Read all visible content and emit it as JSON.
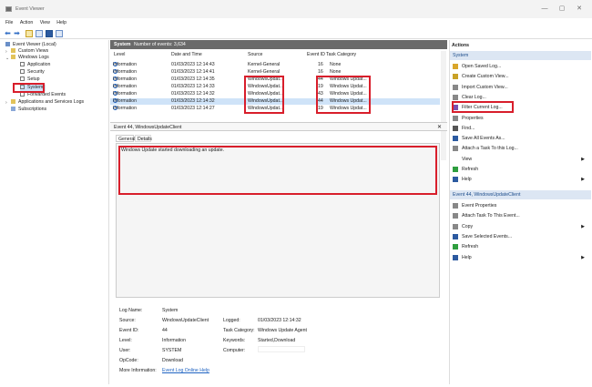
{
  "window": {
    "title": "Event Viewer",
    "minimize": "—",
    "maximize": "▢",
    "close": "✕"
  },
  "menu": [
    "File",
    "Action",
    "View",
    "Help"
  ],
  "tree": {
    "root": "Event Viewer (Local)",
    "custom_views": "Custom Views",
    "windows_logs": "Windows Logs",
    "logs": [
      "Application",
      "Security",
      "Setup",
      "System",
      "Forwarded Events"
    ],
    "app_services": "Applications and Services Logs",
    "subscriptions": "Subscriptions"
  },
  "log_header": {
    "name": "System",
    "count": "Number of events: 3,634"
  },
  "columns": {
    "level": "Level",
    "date": "Date and Time",
    "source": "Source",
    "event_id": "Event ID",
    "task": "Task Category"
  },
  "events": [
    {
      "level": "Information",
      "date": "01/03/2023 12:14:43",
      "source": "Kernel-General",
      "event_id": "16",
      "task": "None"
    },
    {
      "level": "Information",
      "date": "01/03/2023 12:14:41",
      "source": "Kernel-General",
      "event_id": "16",
      "task": "None"
    },
    {
      "level": "Information",
      "date": "01/03/2023 12:14:35",
      "source": "WindowsUpdat...",
      "event_id": "44",
      "task": "Windows Updat..."
    },
    {
      "level": "Information",
      "date": "01/03/2023 12:14:33",
      "source": "WindowsUpdat...",
      "event_id": "19",
      "task": "Windows Updat..."
    },
    {
      "level": "Information",
      "date": "01/03/2023 12:14:32",
      "source": "WindowsUpdat...",
      "event_id": "43",
      "task": "Windows Updat..."
    },
    {
      "level": "Information",
      "date": "01/03/2023 12:14:32",
      "source": "WindowsUpdat...",
      "event_id": "44",
      "task": "Windows Updat..."
    },
    {
      "level": "Information",
      "date": "01/03/2023 12:14:27",
      "source": "WindowsUpdat...",
      "event_id": "19",
      "task": "Windows Updat..."
    }
  ],
  "detail": {
    "title": "Event 44, WindowsUpdateClient",
    "close": "✕",
    "tabs": [
      "General",
      "Details"
    ],
    "message": "Windows Update started downloading an update.",
    "labels": {
      "log_name": "Log Name:",
      "source": "Source:",
      "event_id": "Event ID:",
      "level": "Level:",
      "user": "User:",
      "opcode": "OpCode:",
      "more_info": "More Information:",
      "logged": "Logged:",
      "task_category": "Task Category:",
      "keywords": "Keywords:",
      "computer": "Computer:"
    },
    "values": {
      "log_name": "System",
      "source": "WindowsUpdateClient",
      "event_id": "44",
      "level": "Information",
      "user": "SYSTEM",
      "opcode": "Download",
      "more_info": "Event Log Online Help",
      "logged": "01/03/2023 12:14:32",
      "task_category": "Windows Update Agent",
      "keywords": "Started,Download",
      "computer": ""
    }
  },
  "actions": {
    "header": "Actions",
    "section1": "System",
    "items1": [
      {
        "label": "Open Saved Log...",
        "icon": "folder-icon",
        "color": "#d9a62b"
      },
      {
        "label": "Create Custom View...",
        "icon": "filter-star-icon",
        "color": "#c9a227"
      },
      {
        "label": "Import Custom View...",
        "icon": "import-icon",
        "color": "#888888"
      },
      {
        "label": "Clear Log...",
        "icon": "clear-icon",
        "color": "#888888"
      },
      {
        "label": "Filter Current Log...",
        "icon": "filter-icon",
        "color": "#7a4fb0"
      },
      {
        "label": "Properties",
        "icon": "properties-icon",
        "color": "#888888"
      },
      {
        "label": "Find...",
        "icon": "find-icon",
        "color": "#555555"
      },
      {
        "label": "Save All Events As...",
        "icon": "save-icon",
        "color": "#2c5aa0"
      },
      {
        "label": "Attach a Task To this Log...",
        "icon": "task-icon",
        "color": "#888888"
      },
      {
        "label": "View",
        "icon": "",
        "color": "",
        "submenu": "▶"
      },
      {
        "label": "Refresh",
        "icon": "refresh-icon",
        "color": "#2e9e3f"
      },
      {
        "label": "Help",
        "icon": "help-icon",
        "color": "#2c5aa0",
        "submenu": "▶"
      }
    ],
    "section2": "Event 44, WindowsUpdateClient",
    "items2": [
      {
        "label": "Event Properties",
        "icon": "properties-icon",
        "color": "#888888"
      },
      {
        "label": "Attach Task To This Event...",
        "icon": "task-icon",
        "color": "#888888"
      },
      {
        "label": "Copy",
        "icon": "copy-icon",
        "color": "#888888",
        "submenu": "▶"
      },
      {
        "label": "Save Selected Events...",
        "icon": "save-icon",
        "color": "#2c5aa0"
      },
      {
        "label": "Refresh",
        "icon": "refresh-icon",
        "color": "#2e9e3f"
      },
      {
        "label": "Help",
        "icon": "help-icon",
        "color": "#2c5aa0",
        "submenu": "▶"
      }
    ]
  },
  "colors": {
    "highlight": "#d81e2b",
    "section_bg": "#dce6f3",
    "selected_row": "#cfe3f8"
  }
}
